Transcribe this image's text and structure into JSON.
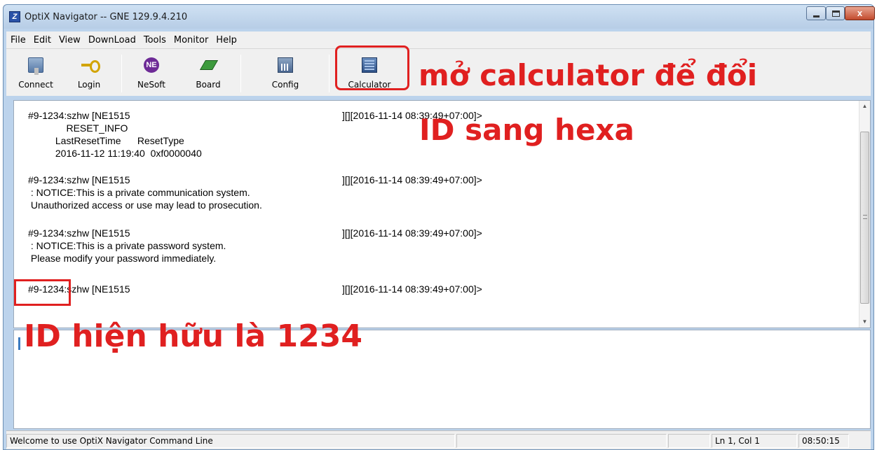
{
  "window": {
    "title": "OptiX Navigator -- GNE 129.9.4.210",
    "close_glyph": "x"
  },
  "menu": {
    "items": [
      {
        "label": "File"
      },
      {
        "label": "Edit"
      },
      {
        "label": "View"
      },
      {
        "label": "DownLoad"
      },
      {
        "label": "Tools"
      },
      {
        "label": "Monitor"
      },
      {
        "label": "Help"
      }
    ]
  },
  "toolbar": {
    "items": [
      {
        "label": "Connect",
        "icon": "connect-icon"
      },
      {
        "label": "Login",
        "icon": "key-icon"
      },
      {
        "label": "NeSoft",
        "icon": "nesoft-icon",
        "icon_text": "NE"
      },
      {
        "label": "Board",
        "icon": "board-icon"
      },
      {
        "label": "Config",
        "icon": "config-icon"
      },
      {
        "label": "Calculator",
        "icon": "calculator-icon"
      }
    ]
  },
  "output": {
    "blocks": [
      {
        "header": "#9-1234:szhw [NE1515",
        "timestamp": "][][2016-11-14 08:39:49+07:00]>",
        "lines": [
          "              RESET_INFO",
          "          LastResetTime      ResetType",
          "          2016-11-12 11:19:40  0xf0000040"
        ]
      },
      {
        "header": "#9-1234:szhw [NE1515",
        "timestamp": "][][2016-11-14 08:39:49+07:00]>",
        "lines": [
          " : NOTICE:This is a private communication system.",
          " Unauthorized access or use may lead to prosecution."
        ]
      },
      {
        "header": "#9-1234:szhw [NE1515",
        "timestamp": "][][2016-11-14 08:39:49+07:00]>",
        "lines": [
          " : NOTICE:This is a private password system.",
          " Please modify your password immediately."
        ]
      },
      {
        "header": "#9-1234:szhw [NE1515",
        "timestamp": "][][2016-11-14 08:39:49+07:00]>",
        "lines": []
      }
    ]
  },
  "annotations": {
    "calculator_note_line1": "mở calculator để đổi",
    "calculator_note_line2": "ID sang hexa",
    "id_note": "ID hiện hữu là 1234",
    "color": "#e02020"
  },
  "statusbar": {
    "message": "Welcome to use OptiX Navigator Command Line",
    "position": "Ln 1, Col 1",
    "time": "08:50:15"
  }
}
